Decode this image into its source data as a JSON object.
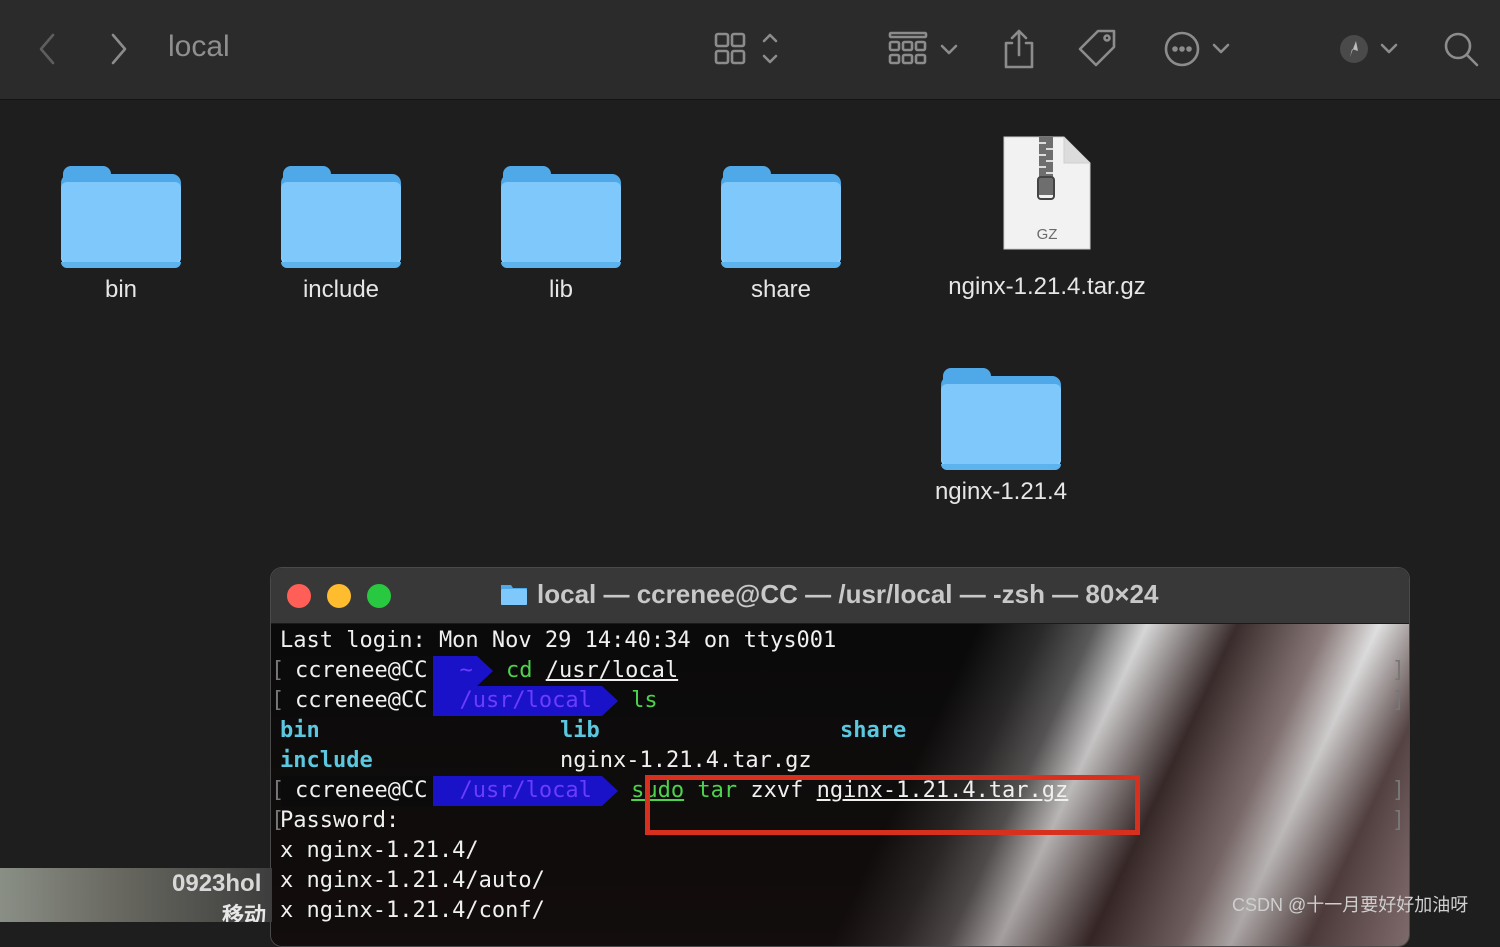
{
  "finder": {
    "title": "local",
    "items": [
      {
        "label": "bin",
        "kind": "folder"
      },
      {
        "label": "include",
        "kind": "folder"
      },
      {
        "label": "lib",
        "kind": "folder"
      },
      {
        "label": "share",
        "kind": "folder"
      },
      {
        "label": "nginx-1.21.4.tar.gz",
        "kind": "archive",
        "badge": "GZ"
      },
      {
        "label": "nginx-1.21.4",
        "kind": "folder"
      }
    ],
    "toolbar_icons": [
      "back-icon",
      "forward-icon",
      "icon-view-icon",
      "group-icon",
      "share-icon",
      "tag-icon",
      "more-actions-icon",
      "airdrop-icon",
      "search-icon"
    ]
  },
  "terminal": {
    "title": "local — ccrenee@CC — /usr/local — -zsh — 80×24",
    "lines": {
      "l1": "Last login: Mon Nov 29 14:40:34 on ttys001",
      "user": "ccrenee@CC",
      "home": "~",
      "cmd1_a": "cd",
      "cmd1_b": "/usr/local",
      "path": "/usr/local",
      "cmd2": "ls",
      "ls_bin": "bin",
      "ls_lib": "lib",
      "ls_share": "share",
      "ls_include": "include",
      "ls_tar": "nginx-1.21.4.tar.gz",
      "cmd3_sudo": "sudo",
      "cmd3_tar": "tar",
      "cmd3_flags": "zxvf",
      "cmd3_file": "nginx-1.21.4.tar.gz",
      "password": "Password:",
      "x1": "x nginx-1.21.4/",
      "x2": "x nginx-1.21.4/auto/",
      "x3": "x nginx-1.21.4/conf/"
    }
  },
  "widget": {
    "line1": "0923hol",
    "line2": "移动"
  },
  "watermark": "CSDN @十一月要好好加油呀",
  "colors": {
    "folder": "#7ec8fb",
    "highlight": "#d8301f",
    "prompt_segment": "#1a12c8"
  }
}
